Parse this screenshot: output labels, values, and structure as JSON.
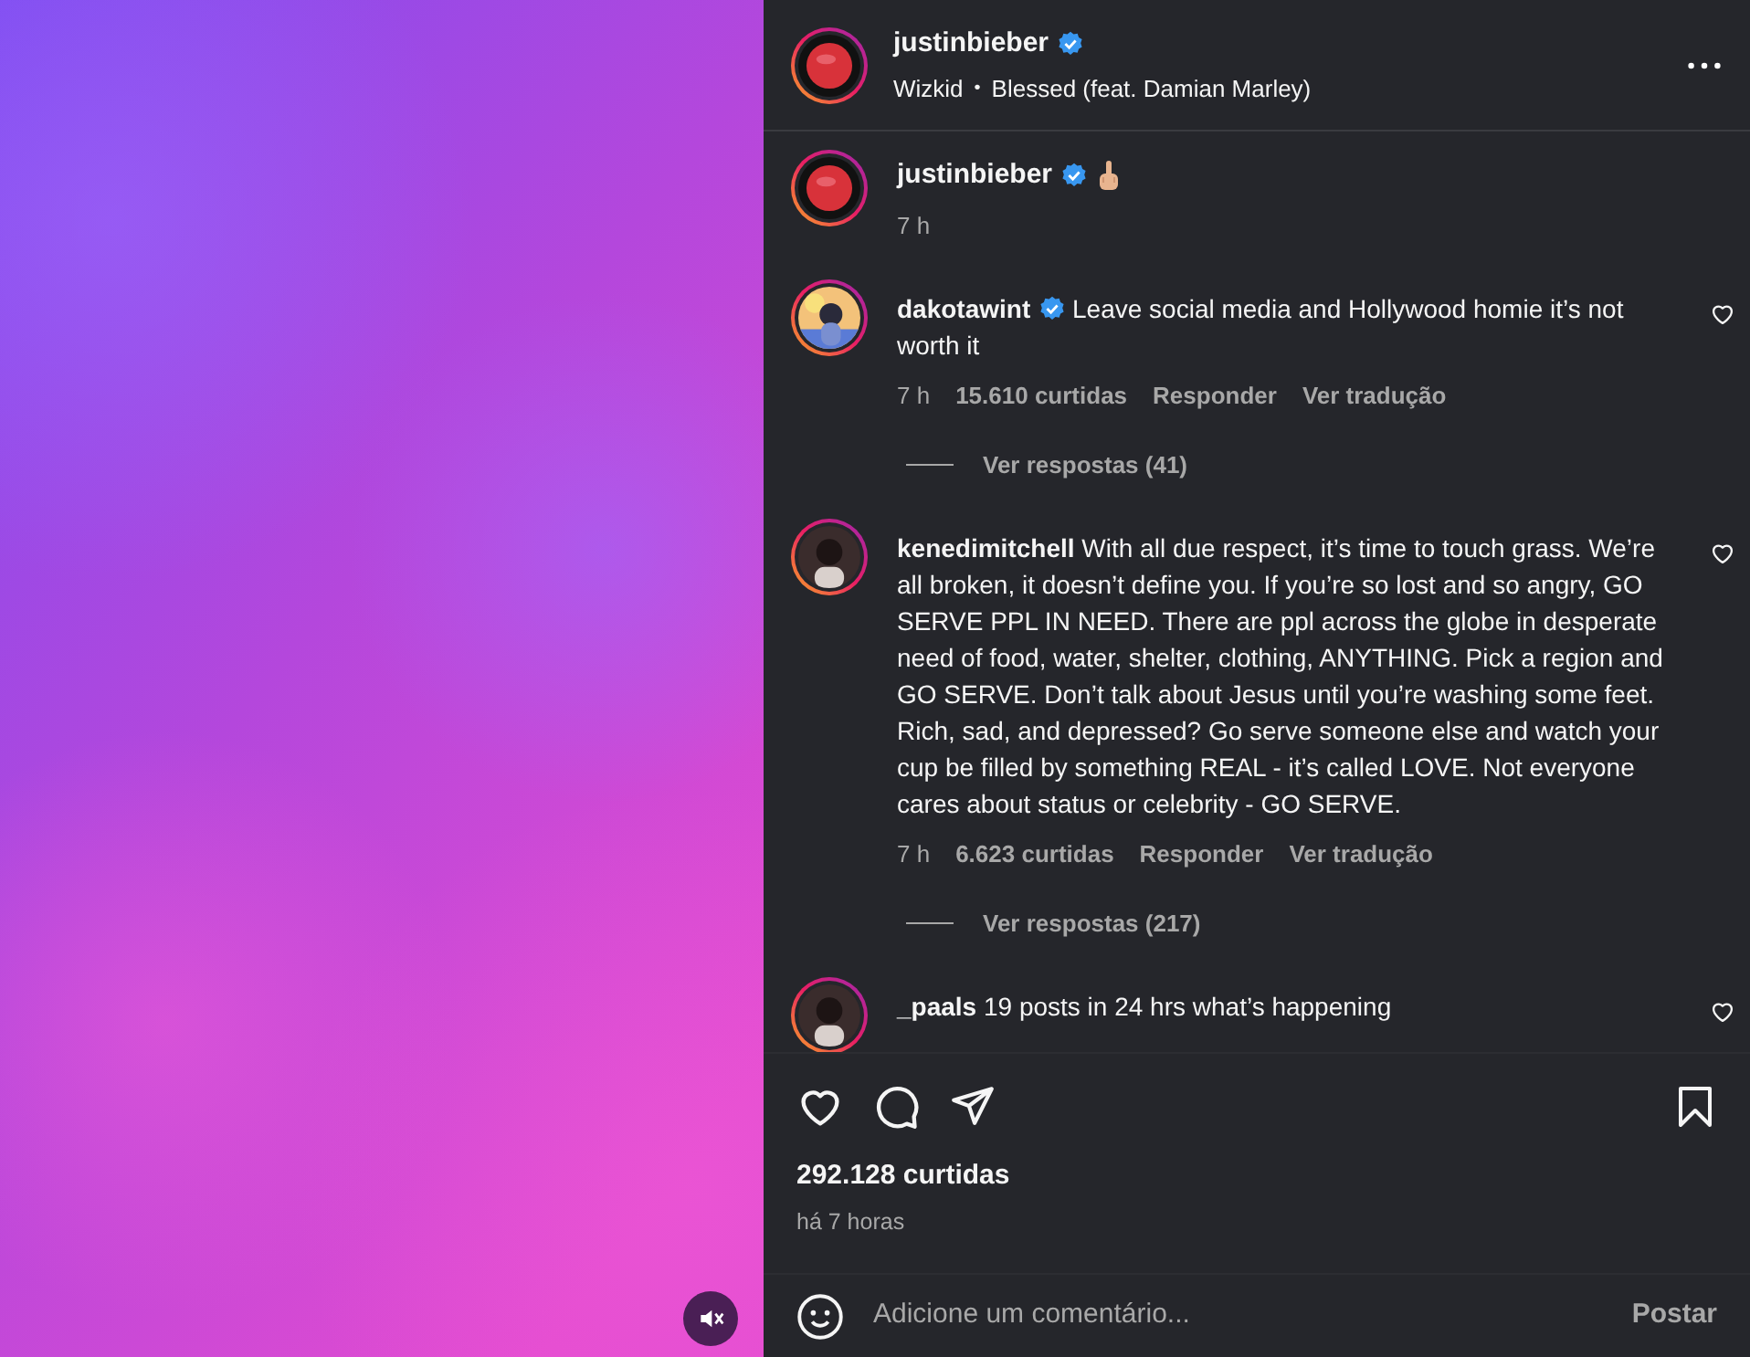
{
  "post_media": {
    "kind": "picture",
    "muted": true
  },
  "header": {
    "username": "justinbieber",
    "verified": true,
    "audio_artist": "Wizkid",
    "separator": "•",
    "audio_track": "Blessed (feat. Damian Marley)"
  },
  "caption": {
    "username": "justinbieber",
    "verified": true,
    "time": "7 h"
  },
  "comments": [
    {
      "username": "dakotawint",
      "verified": true,
      "text": "Leave social media and Hollywood homie it’s not worth it",
      "time": "7 h",
      "likes": "15.610 curtidas",
      "reply": "Responder",
      "translate": "Ver tradução",
      "replies": "Ver respostas (41)"
    },
    {
      "username": "kenedimitchell",
      "verified": false,
      "text": "With all due respect, it’s time to touch grass. We’re all broken, it doesn’t define you. If you’re so lost and so angry, GO SERVE PPL IN NEED. There are ppl across the globe in desperate need of food, water, shelter, clothing, ANYTHING. Pick a region and GO SERVE. Don’t talk about Jesus until you’re washing some feet. Rich, sad, and depressed? Go serve someone else and watch your cup be filled by something REAL - it’s called LOVE. Not everyone cares about status or celebrity - GO SERVE.",
      "time": "7 h",
      "likes": "6.623 curtidas",
      "reply": "Responder",
      "translate": "Ver tradução",
      "replies": "Ver respostas (217)"
    },
    {
      "username": "_paals",
      "verified": false,
      "text": "19 posts in 24 hrs what’s happening"
    }
  ],
  "likes": "292.128 curtidas",
  "posted": "há 7 horas",
  "comment_field": {
    "placeholder": "Adicione um comentário..."
  },
  "post_button": "Postar"
}
